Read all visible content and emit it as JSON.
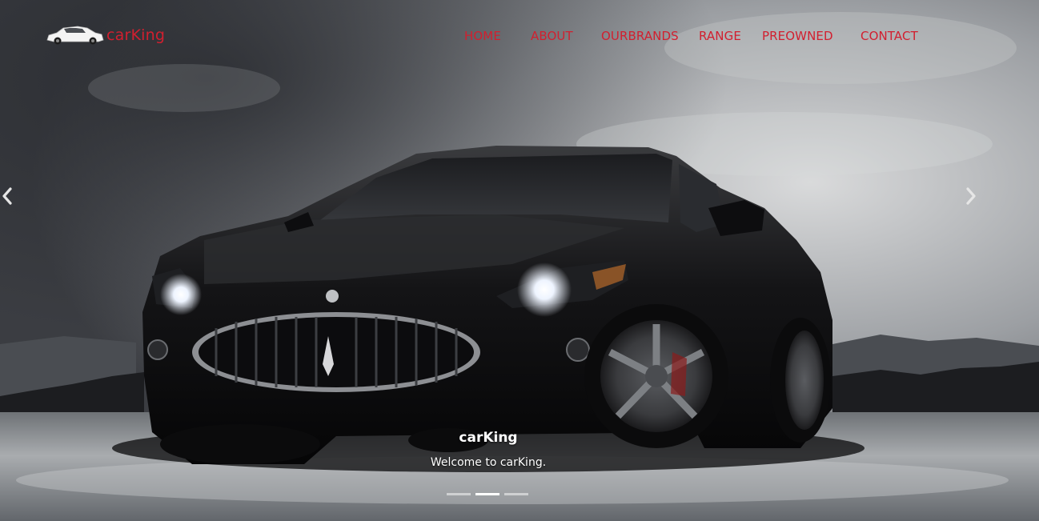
{
  "brand": {
    "name": "carKing",
    "logo_icon": "car-logo-icon"
  },
  "nav": {
    "items": [
      {
        "label": "HOME"
      },
      {
        "label": "ABOUT"
      },
      {
        "label": "OURBRANDS"
      },
      {
        "label": "RANGE"
      },
      {
        "label": "PREOWNED"
      },
      {
        "label": "CONTACT"
      }
    ],
    "color": "#d21f2f"
  },
  "carousel": {
    "caption_title": "carKing",
    "caption_text": "Welcome to carKing.",
    "prev_icon": "chevron-left-icon",
    "next_icon": "chevron-right-icon",
    "slide_count": 3,
    "active_index": 1
  }
}
